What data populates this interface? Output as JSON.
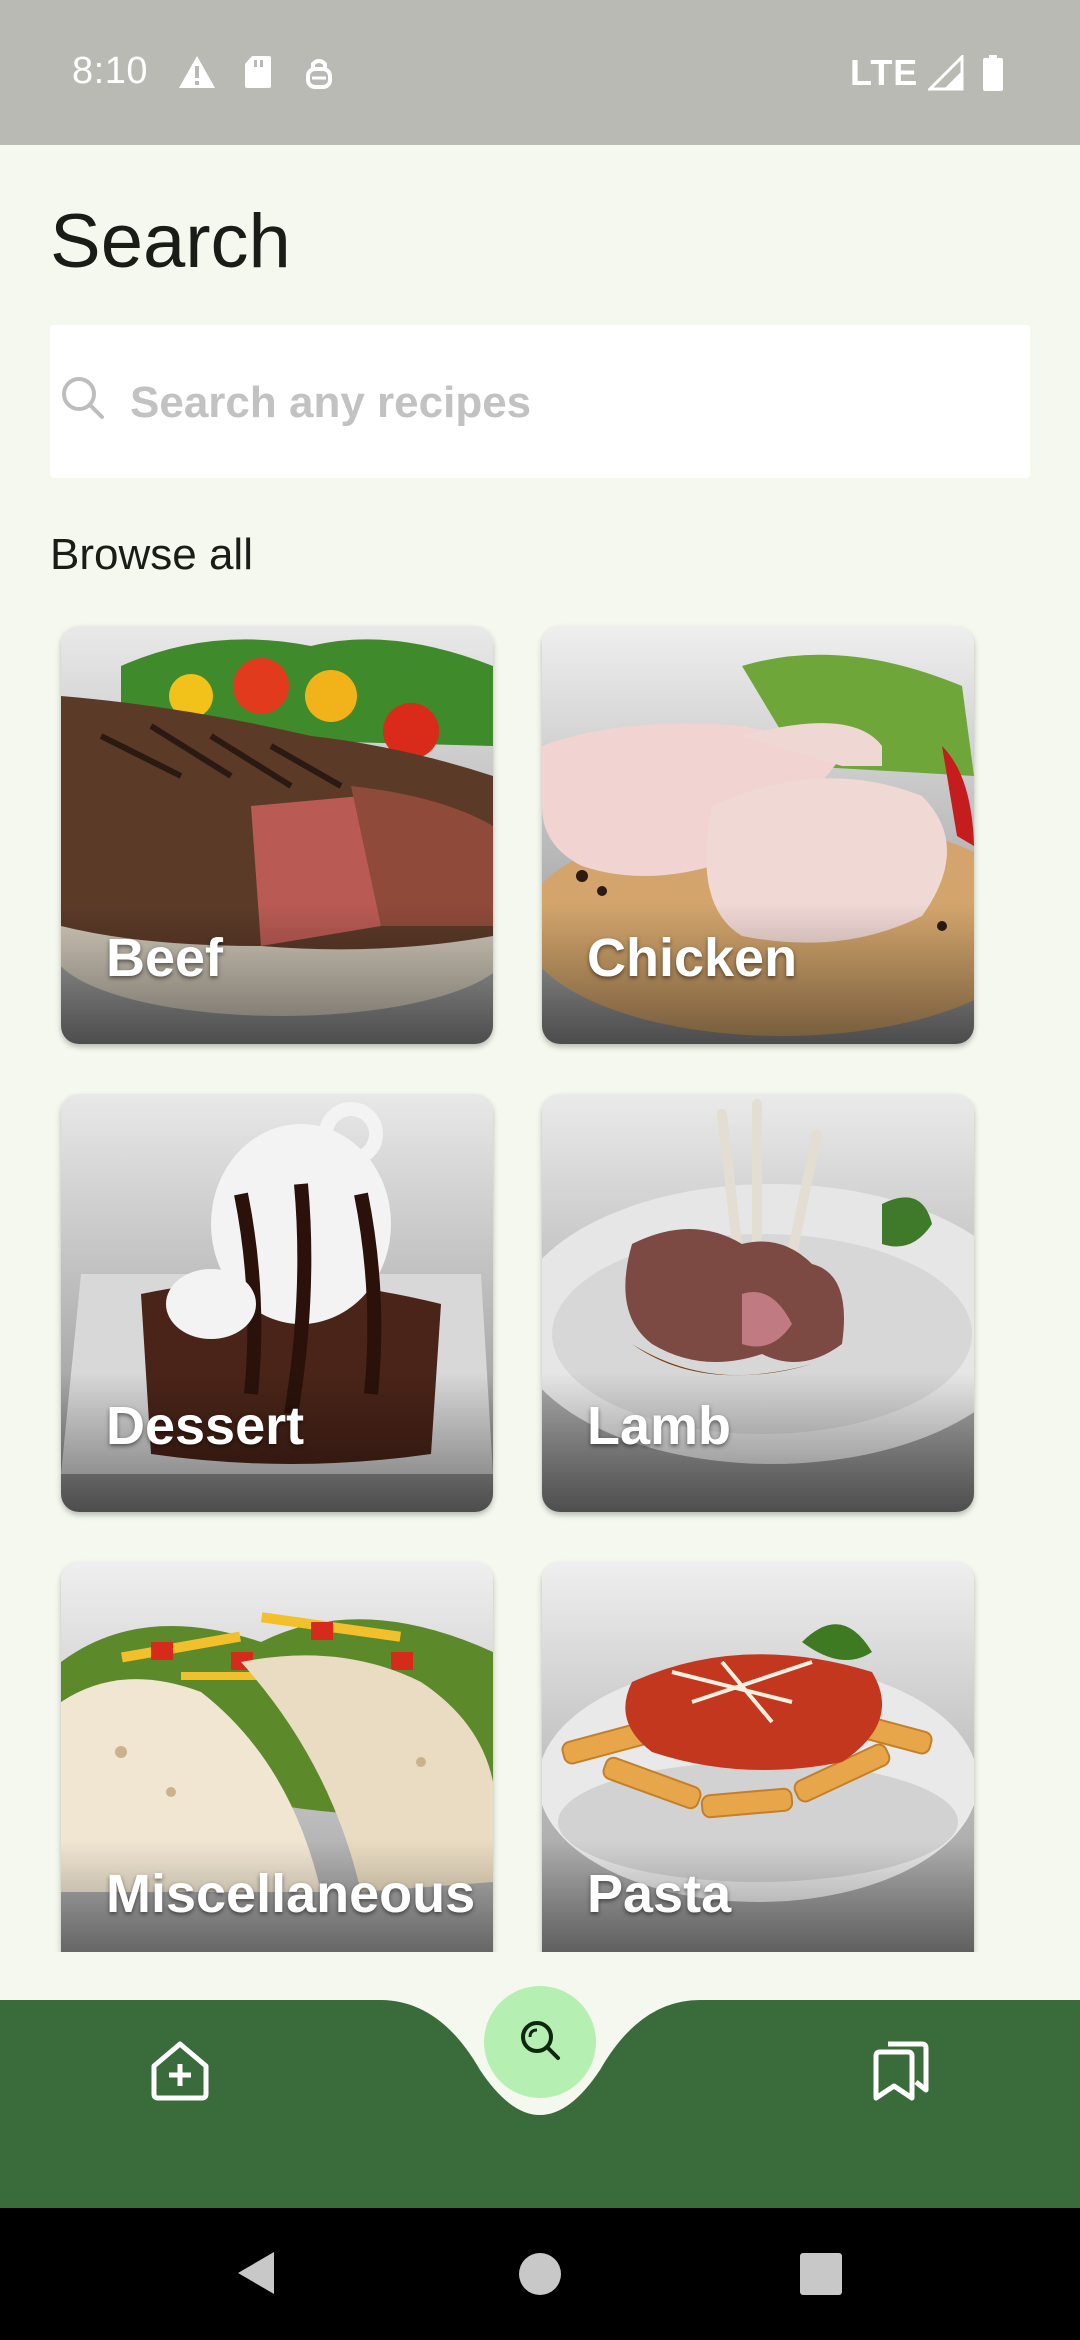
{
  "status_bar": {
    "time": "8:10",
    "network": "LTE",
    "icons": [
      "alert-icon",
      "sd-card-icon",
      "vpn-key-icon",
      "signal-icon",
      "battery-icon"
    ]
  },
  "page": {
    "title": "Search",
    "search_placeholder": "Search any recipes",
    "section_title": "Browse all"
  },
  "categories": [
    {
      "label": "Beef"
    },
    {
      "label": "Chicken"
    },
    {
      "label": "Dessert"
    },
    {
      "label": "Lamb"
    },
    {
      "label": "Miscellaneous"
    },
    {
      "label": "Pasta"
    }
  ],
  "bottom_nav": {
    "items": [
      "add-home-icon",
      "search-icon",
      "bookmarks-icon"
    ],
    "active": "search-icon"
  },
  "colors": {
    "background": "#f4f8ee",
    "nav_green": "#3a6b3a",
    "fab_green": "#b6efb2",
    "status_bar": "#b9bab4"
  }
}
